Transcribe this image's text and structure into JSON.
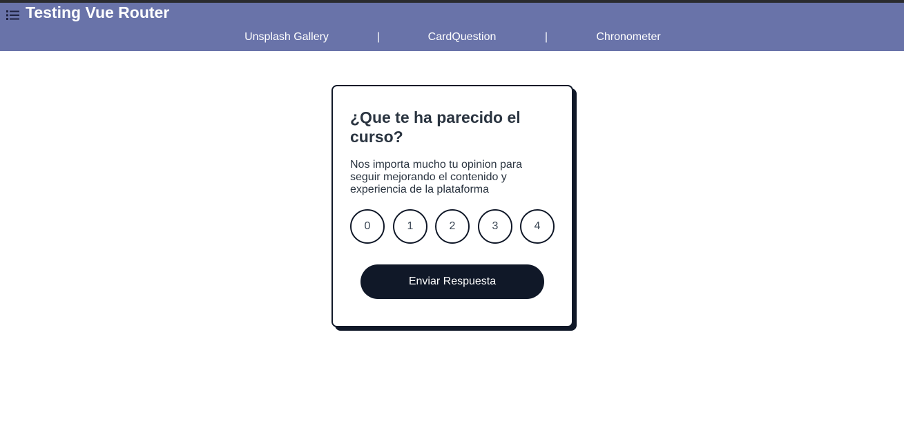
{
  "app": {
    "title": "Testing Vue Router",
    "menu_icon": "list-icon"
  },
  "nav": {
    "links": [
      {
        "label": "Unsplash Gallery"
      },
      {
        "label": "CardQuestion"
      },
      {
        "label": "Chronometer"
      }
    ],
    "separator": "|"
  },
  "card": {
    "title": "¿Que te ha parecido el curso?",
    "description": "Nos importa mucho tu opinion para seguir mejorando el contenido y experiencia de la plataforma",
    "ratings": [
      "0",
      "1",
      "2",
      "3",
      "4"
    ],
    "submit_label": "Enviar Respuesta"
  },
  "colors": {
    "header_bg": "#6973a9",
    "accent_dark": "#101828",
    "text": "#2a3440"
  }
}
